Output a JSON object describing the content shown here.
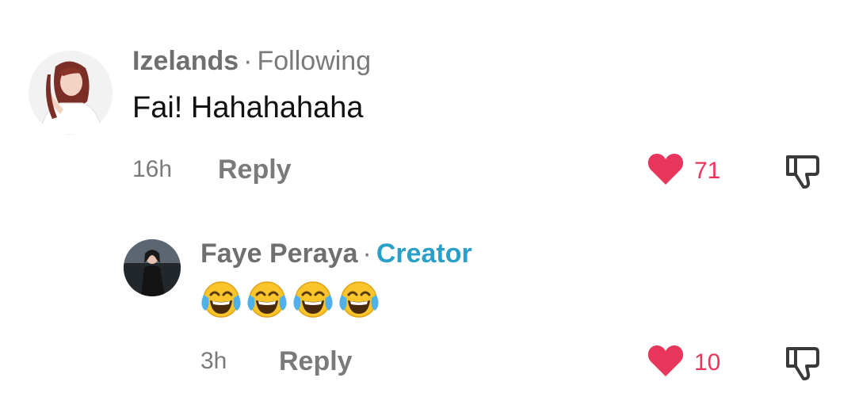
{
  "comments": [
    {
      "username": "Izelands",
      "relation": "Following",
      "text": "Fai! Hahahahaha",
      "time": "16h",
      "reply_label": "Reply",
      "likes": "71",
      "liked": true
    }
  ],
  "replies": [
    {
      "username": "Faye Peraya",
      "badge": "Creator",
      "emoji_text": "😂😂😂😂",
      "emoji_count": 4,
      "time": "3h",
      "reply_label": "Reply",
      "likes": "10",
      "liked": true
    }
  ],
  "icons": {
    "like": "heart-icon",
    "dislike": "thumbs-down-icon",
    "emoji": "face-with-tears-of-joy-icon"
  },
  "colors": {
    "like": "#e8365d",
    "creator_badge": "#2aa0c8",
    "secondary_text": "#7a7a7a"
  }
}
